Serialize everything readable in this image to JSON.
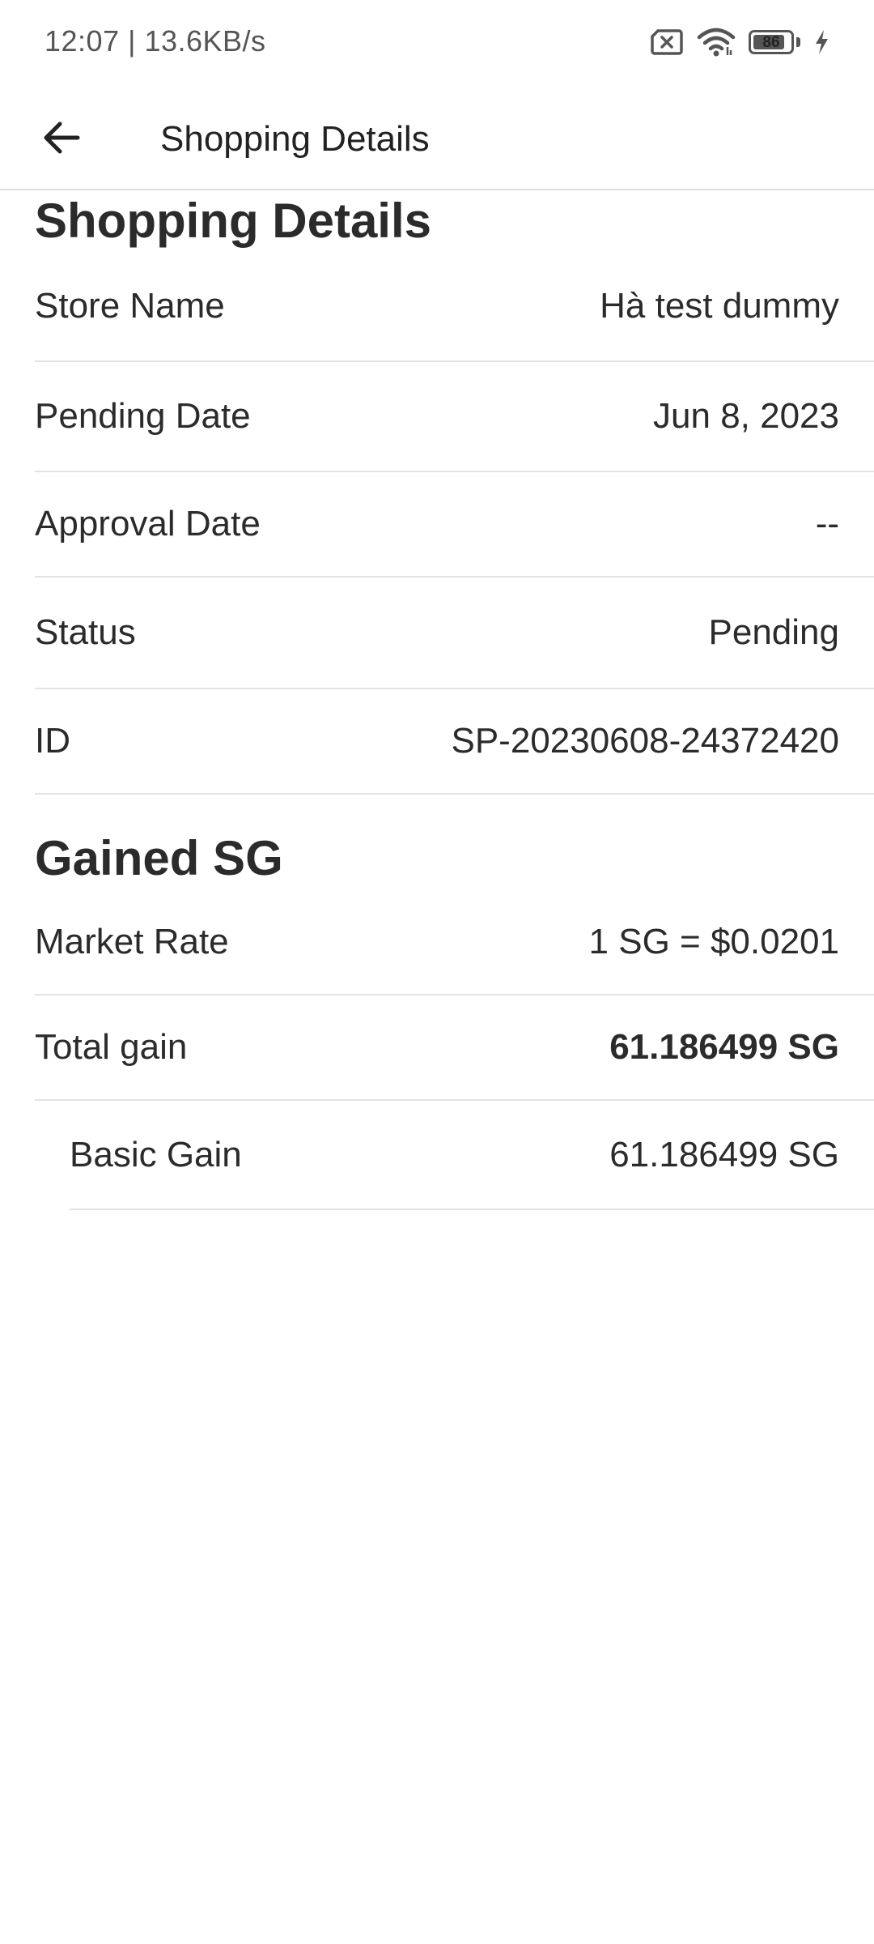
{
  "status_bar": {
    "time_speed": "12:07 | 13.6KB/s",
    "battery_level": "86",
    "battery_fraction": 0.86,
    "icons": [
      "sim-missing-icon",
      "wifi-icon",
      "battery-icon",
      "charging-bolt-icon"
    ]
  },
  "app_bar": {
    "back_icon": "arrow-left-icon",
    "title": "Shopping Details"
  },
  "shopping_details": {
    "heading": "Shopping Details",
    "rows": [
      {
        "label": "Store Name",
        "value": "Hà test dummy"
      },
      {
        "label": "Pending Date",
        "value": "Jun 8, 2023"
      },
      {
        "label": "Approval Date",
        "value": "--"
      },
      {
        "label": "Status",
        "value": "Pending"
      },
      {
        "label": "ID",
        "value": "SP-20230608-24372420"
      }
    ]
  },
  "gained_sg": {
    "heading": "Gained SG",
    "rows": [
      {
        "label": "Market Rate",
        "value": "1 SG = $0.0201"
      },
      {
        "label": "Total gain",
        "value": "61.186499 SG"
      },
      {
        "label": "Basic Gain",
        "value": "61.186499 SG"
      }
    ]
  },
  "colors": {
    "text_primary": "#2b2b2b",
    "divider": "#e3e3e3",
    "background": "#ffffff"
  }
}
